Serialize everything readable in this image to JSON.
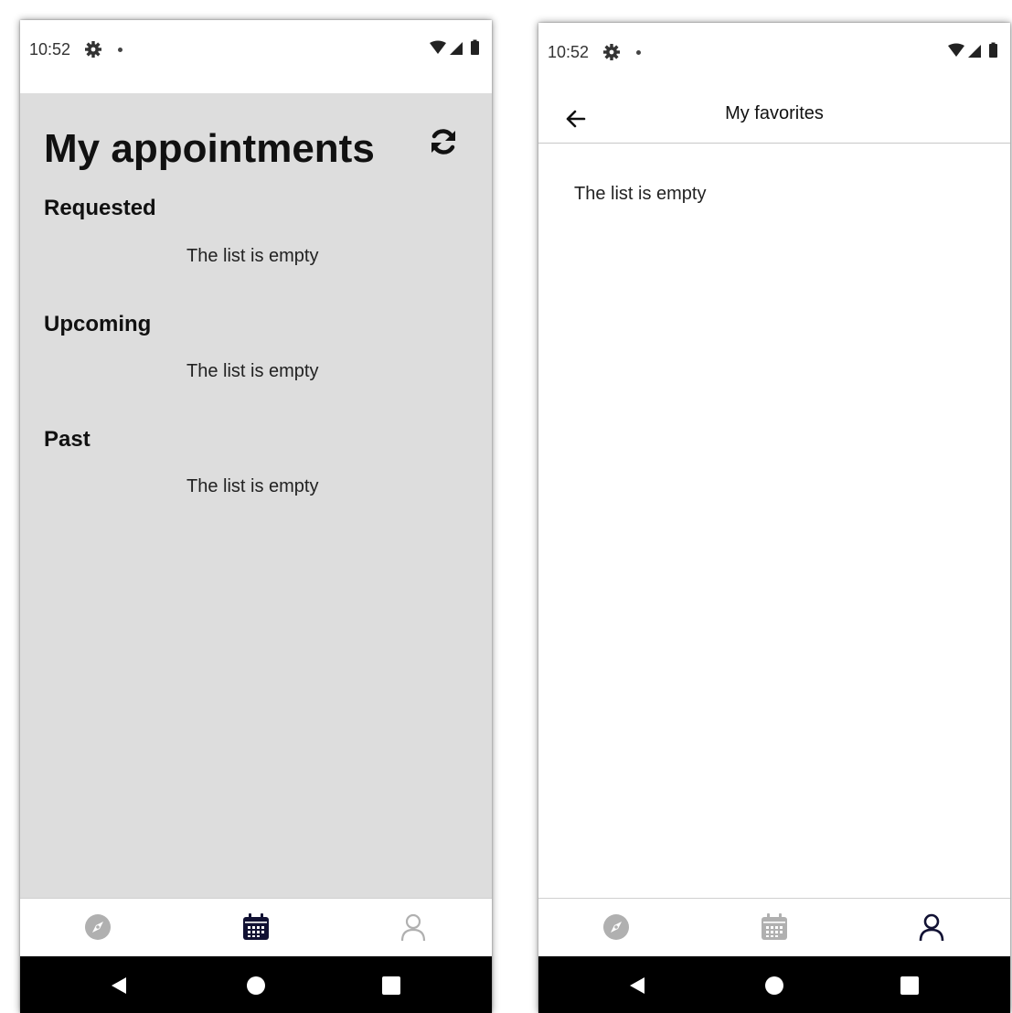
{
  "left_screen": {
    "status_bar": {
      "time": "10:52"
    },
    "title": "My appointments",
    "refresh_icon": "refresh-icon",
    "sections": [
      {
        "header": "Requested",
        "empty_text": "The list is empty"
      },
      {
        "header": "Upcoming",
        "empty_text": "The list is empty"
      },
      {
        "header": "Past",
        "empty_text": "The list is empty"
      }
    ],
    "bottom_nav": {
      "items": [
        "compass-icon",
        "calendar-icon",
        "profile-icon"
      ],
      "active": "calendar-icon"
    }
  },
  "right_screen": {
    "status_bar": {
      "time": "10:52"
    },
    "app_bar": {
      "title": "My favorites",
      "back_icon": "back-arrow-icon"
    },
    "empty_text": "The list is empty",
    "bottom_nav": {
      "items": [
        "compass-icon",
        "calendar-icon",
        "profile-icon"
      ],
      "active": "profile-icon"
    }
  },
  "colors": {
    "gray_background": "#dddddd",
    "active_nav": "#111133",
    "inactive_nav": "#b0b0b0",
    "system_nav_bar": "#000000"
  },
  "system_nav": [
    "back-triangle-icon",
    "home-circle-icon",
    "recents-square-icon"
  ]
}
